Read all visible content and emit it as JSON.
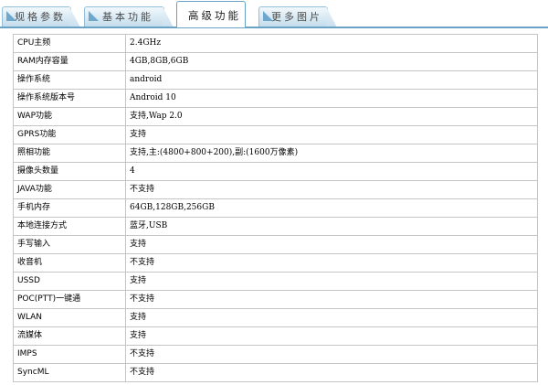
{
  "tabs": [
    {
      "label": "规格参数",
      "active": false
    },
    {
      "label": "基本功能",
      "active": false
    },
    {
      "label": "高级功能",
      "active": true
    },
    {
      "label": "更多图片",
      "active": false
    }
  ],
  "specs": [
    {
      "key": "CPU主频",
      "value": "2.4GHz"
    },
    {
      "key": "RAM内存容量",
      "value": "4GB,8GB,6GB"
    },
    {
      "key": "操作系统",
      "value": "android"
    },
    {
      "key": "操作系统版本号",
      "value": "Android 10"
    },
    {
      "key": "WAP功能",
      "value": "支持,Wap 2.0"
    },
    {
      "key": "GPRS功能",
      "value": "支持"
    },
    {
      "key": "照相功能",
      "value": "支持,主:(4800+800+200),副:(1600万像素)"
    },
    {
      "key": "摄像头数量",
      "value": "4"
    },
    {
      "key": "JAVA功能",
      "value": "不支持"
    },
    {
      "key": "手机内存",
      "value": "64GB,128GB,256GB"
    },
    {
      "key": "本地连接方式",
      "value": "蓝牙,USB"
    },
    {
      "key": "手写输入",
      "value": "支持"
    },
    {
      "key": "收音机",
      "value": "不支持"
    },
    {
      "key": "USSD",
      "value": "支持"
    },
    {
      "key": "POC(PTT)一键通",
      "value": "不支持"
    },
    {
      "key": "WLAN",
      "value": "支持"
    },
    {
      "key": "流媒体",
      "value": "支持"
    },
    {
      "key": "IMPS",
      "value": "不支持"
    },
    {
      "key": "SyncML",
      "value": "不支持"
    }
  ],
  "colors": {
    "tab_border": "#6aa2c6",
    "tab_fill": "#d6e8f3",
    "table_border": "#c5c5c5"
  }
}
